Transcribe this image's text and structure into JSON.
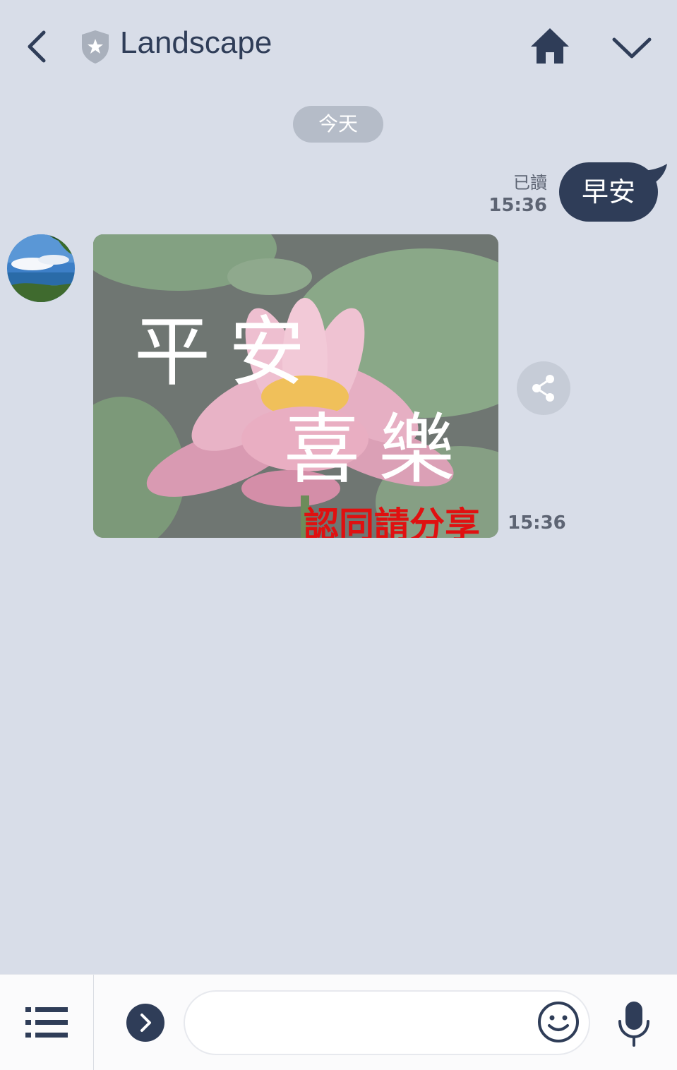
{
  "header": {
    "title": "Landscape",
    "back_icon": "chevron-left-icon",
    "shield_icon": "shield-star-icon",
    "home_icon": "home-icon",
    "menu_icon": "chevron-down-icon"
  },
  "chat": {
    "date_separator": "今天",
    "messages": [
      {
        "direction": "outgoing",
        "text": "早安",
        "read_label": "已讀",
        "time": "15:36"
      },
      {
        "direction": "incoming",
        "type": "image",
        "overlay_line1": "平安",
        "overlay_line2": "喜樂",
        "overlay_caption": "認同請分享",
        "time": "15:36"
      }
    ]
  },
  "input_bar": {
    "menu_icon": "list-icon",
    "expand_icon": "chevron-right-circle-icon",
    "message_placeholder": "",
    "emoji_icon": "smiley-icon",
    "mic_icon": "microphone-icon"
  },
  "colors": {
    "background": "#d8dde8",
    "header_text": "#2f3d58",
    "outgoing_bubble": "#2f3d58",
    "caption_red": "#e01010"
  }
}
